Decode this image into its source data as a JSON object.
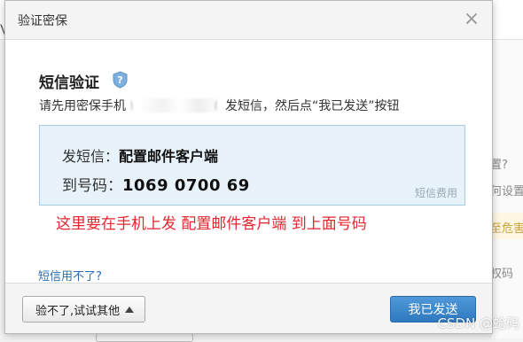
{
  "dialog": {
    "title": "验证密保",
    "close_glyph": "×"
  },
  "body": {
    "section_title": "短信验证",
    "help_icon": "shield-question-icon",
    "instruction_prefix": "请先用密保手机",
    "instruction_suffix": "发短信，然后点“我已发送”按钮",
    "sms_content_label": "发短信：",
    "sms_content_value": "配置邮件客户端",
    "sms_number_label": "到号码：",
    "sms_number_value": "1069 0700 69",
    "sms_fee_label": "短信费用",
    "annotation": "这里要在手机上发 配置邮件客户端 到上面号码",
    "sms_fail_link": "短信用不了?"
  },
  "footer": {
    "alt_button_label": "验不了,试试其他",
    "sent_button_label": "我已发送"
  },
  "background": {
    "left_fragment": "V",
    "right_fragments": [
      "置?",
      "何设置",
      "至危害",
      "权码"
    ]
  },
  "watermark": "CSDN @蛤码",
  "colors": {
    "accent_blue": "#2f79c0",
    "link_blue": "#2a6db7",
    "annotation_red": "#e3262f",
    "sms_box_bg": "#e7f2fa"
  }
}
